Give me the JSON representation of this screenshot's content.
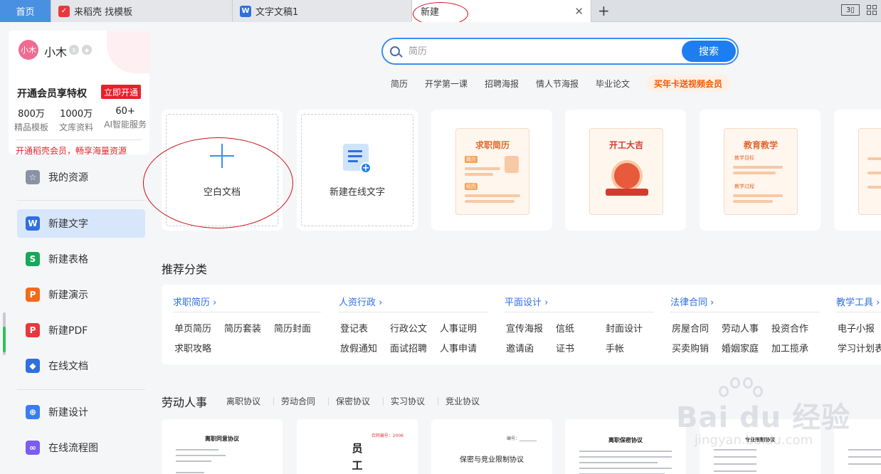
{
  "tabs": {
    "home": "首页",
    "tab1": "来稻壳 找模板",
    "tab2": "文字文稿1",
    "tab3": "新建",
    "badge": "3"
  },
  "user": {
    "avatar": "小木",
    "name": "小木",
    "vip_title": "开通会员享特权",
    "vip_button": "立即开通",
    "stats": [
      {
        "value": "800万",
        "label": "精品模板"
      },
      {
        "value": "1000万",
        "label": "文库资料"
      },
      {
        "value": "60+",
        "label": "AI智能服务"
      }
    ],
    "promo_link": "开通稻壳会员，畅享海量资源"
  },
  "nav": {
    "resources": "我的资源",
    "items": [
      {
        "label": "新建文字",
        "icon": "W",
        "color": "#2f6fde"
      },
      {
        "label": "新建表格",
        "icon": "S",
        "color": "#17a85a"
      },
      {
        "label": "新建演示",
        "icon": "P",
        "color": "#f26a1b"
      },
      {
        "label": "新建PDF",
        "icon": "P",
        "color": "#e8383d"
      },
      {
        "label": "在线文档",
        "icon": "◆",
        "color": "#2f6fde"
      },
      {
        "label": "新建设计",
        "icon": "⊕",
        "color": "#3b7df0"
      },
      {
        "label": "在线流程图",
        "icon": "∞",
        "color": "#7a5cf0"
      }
    ]
  },
  "search": {
    "placeholder": "简历",
    "button": "搜索",
    "hotwords": [
      "简历",
      "开学第一课",
      "招聘海报",
      "情人节海报",
      "毕业论文"
    ],
    "promo": "买年卡送视频会员"
  },
  "cards": {
    "blank": "空白文档",
    "online": "新建在线文字",
    "templates": [
      {
        "title": "求职简历",
        "tag1": "简介",
        "tag2": "经历"
      },
      {
        "title": "开工大吉"
      },
      {
        "title": "教育教学",
        "tag1": "教学目标",
        "tag2": "教学过程"
      }
    ]
  },
  "recommend": {
    "title": "推荐分类",
    "columns": [
      {
        "head": "求职简历",
        "items": [
          "单页简历",
          "简历套装",
          "简历封面",
          "求职攻略"
        ]
      },
      {
        "head": "人资行政",
        "items": [
          "登记表",
          "行政公文",
          "人事证明",
          "放假通知",
          "面试招聘",
          "人事申请"
        ]
      },
      {
        "head": "平面设计",
        "items": [
          "宣传海报",
          "信纸",
          "封面设计",
          "邀请函",
          "证书",
          "手帐"
        ]
      },
      {
        "head": "法律合同",
        "items": [
          "房屋合同",
          "劳动人事",
          "投资合作",
          "买卖购销",
          "婚姻家庭",
          "加工揽承"
        ]
      },
      {
        "head": "教学工具",
        "items": [
          "电子小报",
          "学习计划表"
        ]
      }
    ]
  },
  "labor": {
    "title": "劳动人事",
    "tabs": [
      "离职协议",
      "劳动合同",
      "保密协议",
      "实习协议",
      "竞业协议"
    ],
    "docs": [
      {
        "title": "离职同意协议"
      },
      {
        "title": "员",
        "title2": "工",
        "note": "合同编号：2006"
      },
      {
        "title": "保密与竞业限制协议",
        "note": "编号：________"
      },
      {
        "title": "离职保密协议"
      },
      {
        "title": "专业限制协议"
      }
    ]
  },
  "watermark": {
    "text": "Bai du 经验",
    "sub": "jingyan.baidu.com"
  }
}
